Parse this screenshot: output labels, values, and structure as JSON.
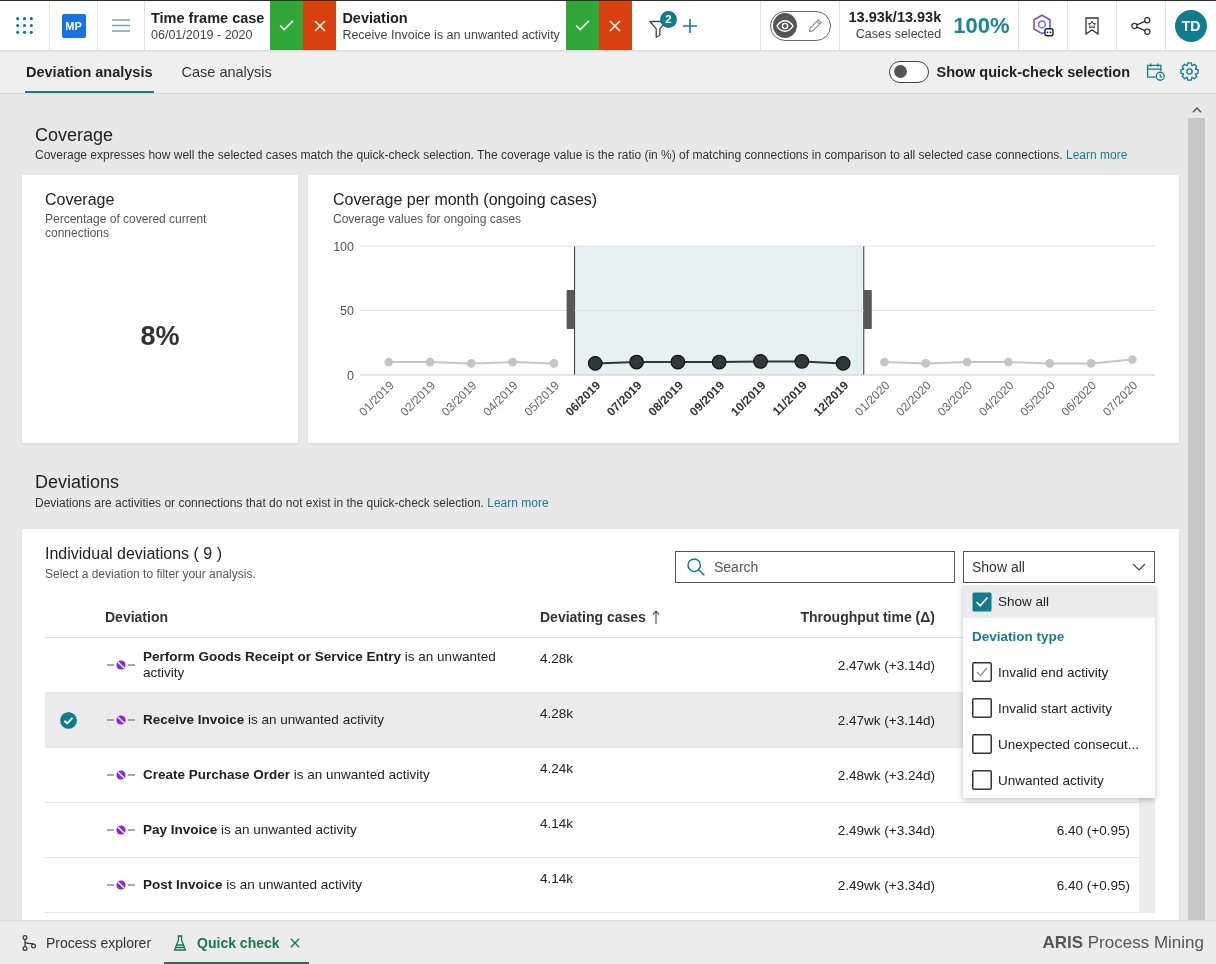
{
  "top_bar": {
    "logo": "MP",
    "filters": [
      {
        "title": "Time frame case",
        "value": "06/01/2019 - 2020"
      },
      {
        "title": "Deviation",
        "value": "Receive Invoice is an unwanted activity"
      }
    ],
    "filter_count": "2",
    "mode_toggle": [
      {
        "kind": "view",
        "selected": true
      },
      {
        "kind": "edit",
        "selected": false
      }
    ],
    "cases": {
      "value": "13.93k/13.93k",
      "label": "Cases selected",
      "percent": "100%"
    },
    "avatar": "TD"
  },
  "tabs": [
    {
      "label": "Deviation analysis",
      "selected": true
    },
    {
      "label": "Case analysis",
      "selected": false
    }
  ],
  "quick_check_toggle": {
    "label": "Show quick-check selection",
    "on": false
  },
  "coverage": {
    "title": "Coverage",
    "description": "Coverage expresses how well the selected cases match the quick-check selection. The coverage value is the ratio (in %) of matching connections in comparison to all selected case connections.",
    "link": "Learn more",
    "kpi": {
      "title": "Coverage",
      "subtitle": "Percentage of covered current connections",
      "value": "8%"
    },
    "chart": {
      "title": "Coverage per month (ongoing cases)",
      "subtitle": "Coverage values for ongoing cases",
      "chart_data": {
        "type": "line",
        "categories": [
          "01/2019",
          "02/2019",
          "03/2019",
          "04/2019",
          "05/2019",
          "06/2019",
          "07/2019",
          "08/2019",
          "09/2019",
          "10/2019",
          "11/2019",
          "12/2019",
          "01/2020",
          "02/2020",
          "03/2020",
          "04/2020",
          "05/2020",
          "06/2020",
          "07/2020"
        ],
        "ylim": [
          0,
          100
        ],
        "yticks": [
          0,
          50,
          100
        ],
        "ref_lines": [
          {
            "axis": "y",
            "value": 50
          },
          {
            "axis": "y",
            "value": 100
          }
        ],
        "series": [
          {
            "color": "#c4c4c4",
            "marker": "dot",
            "values": [
              10,
              10,
              9,
              10,
              9,
              null,
              null,
              null,
              null,
              null,
              null,
              null,
              10,
              9,
              10,
              10,
              9,
              9,
              12
            ]
          },
          {
            "color": "#2e3a3a",
            "marker": "circle",
            "values": [
              null,
              null,
              null,
              null,
              null,
              9,
              10,
              10,
              10,
              10.5,
              10.5,
              9,
              null,
              null,
              null,
              null,
              null,
              null,
              null
            ]
          }
        ],
        "bands": [
          {
            "axis": "x",
            "from": "06/2019",
            "to": "12/2019",
            "color": "#e6f1f2"
          }
        ]
      }
    }
  },
  "deviations": {
    "title": "Deviations",
    "description": "Deviations are activities or connections that do not exist in the quick-check selection.",
    "link": "Learn more",
    "table": {
      "title": "Individual deviations ( 9 )",
      "subtitle": "Select a deviation to filter your analysis.",
      "search": {
        "placeholder": "Search"
      },
      "filter": {
        "value": "Show all",
        "expanded": true,
        "options": [
          {
            "kind": "all",
            "label": "Show all",
            "checked": true,
            "highlighted": true
          },
          {
            "kind": "heading",
            "label": "Deviation type"
          },
          {
            "kind": "type",
            "label": "Invalid end activity",
            "checked": true,
            "highlighted": false
          },
          {
            "kind": "type",
            "label": "Invalid start activity",
            "checked": false,
            "highlighted": false
          },
          {
            "kind": "type",
            "label": "Unexpected consecut...",
            "checked": false,
            "highlighted": false
          },
          {
            "kind": "type",
            "label": "Unwanted activity",
            "checked": false,
            "highlighted": false
          }
        ]
      },
      "columns": [
        {
          "label": "Deviation",
          "sorted": false
        },
        {
          "label": "Deviating cases",
          "sorted": true
        },
        {
          "label": "Throughput time (Δ)",
          "sorted": false
        }
      ],
      "rows": [
        {
          "deviation": "**Perform Goods Receipt or Service Entry** is an unwanted activity",
          "cases": "4.28k",
          "throughput": "2.47wk (+3.14d)",
          "selected": false
        },
        {
          "deviation": "**Receive Invoice** is an unwanted activity",
          "cases": "4.28k",
          "throughput": "2.47wk (+3.14d)",
          "selected": true
        },
        {
          "deviation": "**Create Purchase Order** is an unwanted activity",
          "cases": "4.24k",
          "throughput": "2.48wk (+3.24d)",
          "selected": false
        },
        {
          "deviation": "**Pay Invoice** is an unwanted activity",
          "cases": "4.14k",
          "throughput": "2.49wk (+3.34d)",
          "column_4": "6.40 (+0.95)",
          "selected": false
        },
        {
          "deviation": "**Post Invoice** is an unwanted activity",
          "cases": "4.14k",
          "throughput": "2.49wk (+3.34d)",
          "column_4": "6.40 (+0.95)",
          "selected": false
        }
      ]
    }
  },
  "bottom_bar": {
    "tabs": [
      {
        "kind": "explorer",
        "label": "Process explorer",
        "selected": false,
        "closable": false
      },
      {
        "kind": "quick_check",
        "label": "Quick check",
        "selected": true,
        "closable": true
      }
    ],
    "brand": "**ARIS** Process Mining"
  }
}
